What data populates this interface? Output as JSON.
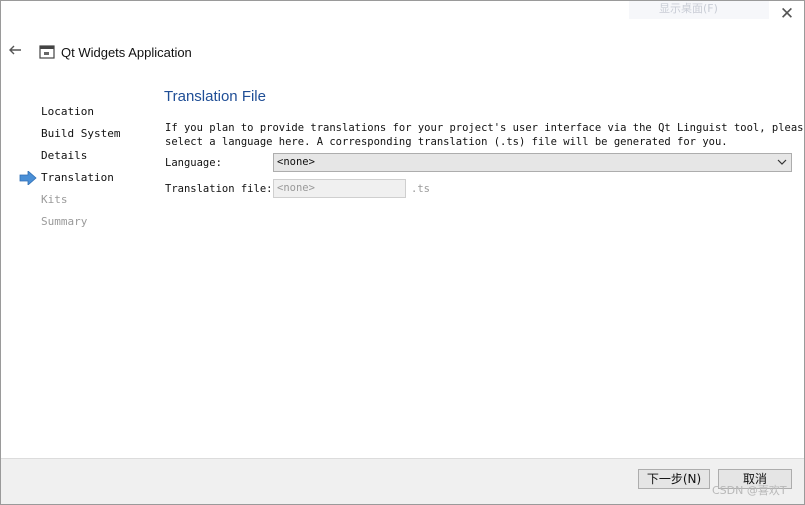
{
  "window": {
    "title": "Qt Widgets Application",
    "ghost_tooltip": "显示桌面(F)",
    "close_glyph": "✕",
    "back_glyph": "🡐"
  },
  "steps": [
    {
      "label": "Location",
      "state": "done"
    },
    {
      "label": "Build System",
      "state": "done"
    },
    {
      "label": "Details",
      "state": "done"
    },
    {
      "label": "Translation",
      "state": "current"
    },
    {
      "label": "Kits",
      "state": "pending"
    },
    {
      "label": "Summary",
      "state": "pending"
    }
  ],
  "page": {
    "title": "Translation File",
    "description_line1": "If you plan to provide translations for your project's user interface via the Qt Linguist tool, please",
    "description_line2": "select a language here. A corresponding translation (.ts) file will be generated for you.",
    "language_label": "Language:",
    "language_value": "<none>",
    "file_label": "Translation file:",
    "file_placeholder": "<none>",
    "file_suffix": ".ts"
  },
  "footer": {
    "next_label": "下一步(N)",
    "cancel_label": "取消"
  },
  "watermark": "CSDN @喜欢T",
  "colors": {
    "title_blue": "#1f4e96",
    "arrow_blue": "#4a8fd6"
  }
}
